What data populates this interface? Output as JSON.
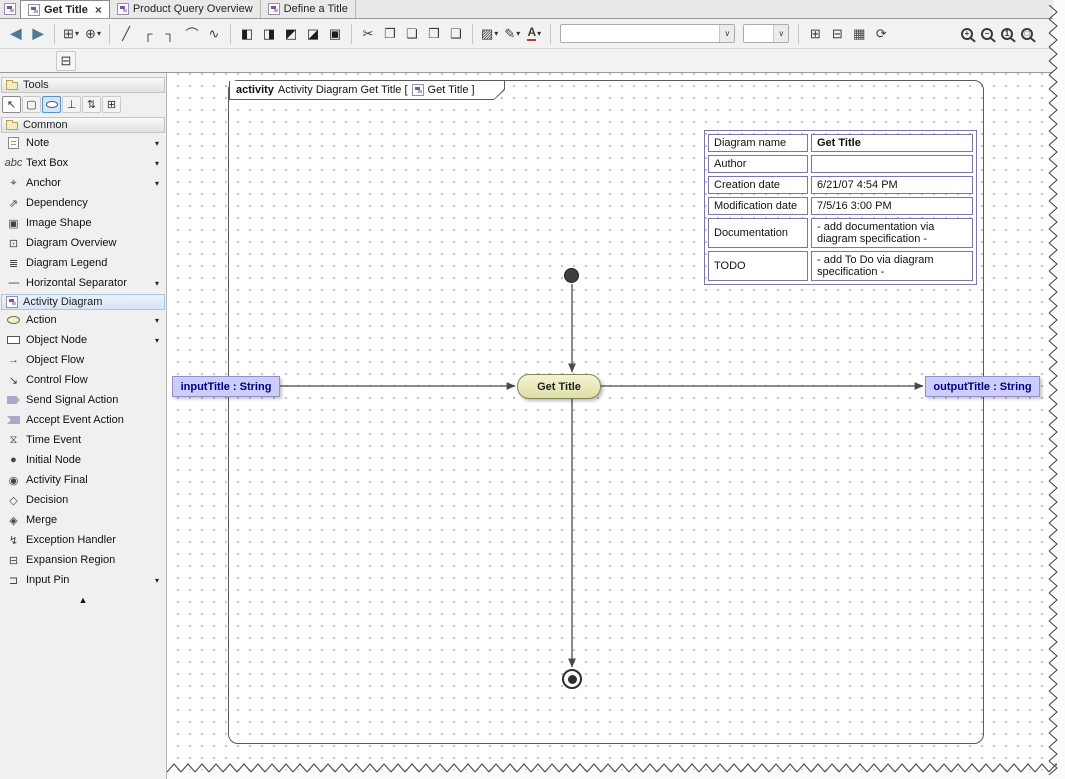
{
  "glyphs": {
    "dd": "▾",
    "combo": "∨",
    "close": "×",
    "collapse": "▲"
  },
  "tabs": {
    "items": [
      {
        "label": "Get Title"
      },
      {
        "label": "Product Query Overview"
      },
      {
        "label": "Define a Title"
      }
    ]
  },
  "toolbar": {
    "nav": {
      "back": "◀",
      "forward": "▶"
    },
    "tree": "⊞",
    "add_related": "⊕",
    "paths": [
      "╱",
      "┌",
      "┐",
      "⌒",
      "∿"
    ],
    "aligns": [
      "◧",
      "◨",
      "◩",
      "◪",
      "▣"
    ],
    "clipboard": [
      "✂",
      "❐",
      "❏",
      "❒",
      "❑"
    ],
    "style": {
      "fill": "▨",
      "pen": "✎",
      "font": "A"
    },
    "extras": [
      "⊞",
      "⊟",
      "▦",
      "⟳"
    ],
    "zoom": [
      "+",
      "−",
      "1",
      "□"
    ],
    "row2": "⊟"
  },
  "sidebar": {
    "tools_header": "Tools",
    "tool_icons": [
      "↖",
      "▢",
      "",
      "⊥",
      "⇅",
      "⊞"
    ],
    "common_header": "Common",
    "common": [
      {
        "label": "Note",
        "icon": ""
      },
      {
        "label": "Text Box",
        "icon": "abc"
      },
      {
        "label": "Anchor",
        "icon": "⌖"
      },
      {
        "label": "Dependency",
        "icon": "⇗"
      },
      {
        "label": "Image Shape",
        "icon": "▣"
      },
      {
        "label": "Diagram Overview",
        "icon": "⊡"
      },
      {
        "label": "Diagram Legend",
        "icon": "≣"
      },
      {
        "label": "Horizontal Separator",
        "icon": "----"
      }
    ],
    "activity_header": "Activity Diagram",
    "activity": [
      {
        "label": "Action",
        "icon": ""
      },
      {
        "label": "Object Node",
        "icon": ""
      },
      {
        "label": "Object Flow",
        "icon": "→"
      },
      {
        "label": "Control Flow",
        "icon": "↘"
      },
      {
        "label": "Send Signal Action",
        "icon": ""
      },
      {
        "label": "Accept Event Action",
        "icon": ""
      },
      {
        "label": "Time Event",
        "icon": "⧖"
      },
      {
        "label": "Initial Node",
        "icon": "●"
      },
      {
        "label": "Activity Final",
        "icon": "◉"
      },
      {
        "label": "Decision",
        "icon": "◇"
      },
      {
        "label": "Merge",
        "icon": "◈"
      },
      {
        "label": "Exception Handler",
        "icon": "↯"
      },
      {
        "label": "Expansion Region",
        "icon": "⊟"
      },
      {
        "label": "Input Pin",
        "icon": "⊐"
      }
    ]
  },
  "diagram": {
    "frame": {
      "keyword": "activity",
      "title": "Activity Diagram Get Title [",
      "bracket": "Get Title ]"
    },
    "info": {
      "rows": [
        {
          "label": "Diagram name",
          "value": "Get Title"
        },
        {
          "label": "Author",
          "value": ""
        },
        {
          "label": "Creation date",
          "value": "6/21/07 4:54 PM"
        },
        {
          "label": "Modification date",
          "value": "7/5/16 3:00 PM"
        },
        {
          "label": "Documentation",
          "value": "- add documentation via diagram specification -"
        },
        {
          "label": "TODO",
          "value": "- add To Do via diagram specification -"
        }
      ]
    },
    "action_label": "Get Title",
    "input_label": "inputTitle : String",
    "output_label": "outputTitle : String"
  },
  "colors": {
    "action_fill": "#e9e9c4",
    "param_fill": "#ccccff",
    "param_text": "#00007d",
    "table_border": "#7777aa",
    "flow": "#4a4a4a",
    "selected_tool": "#d5e5f8"
  }
}
